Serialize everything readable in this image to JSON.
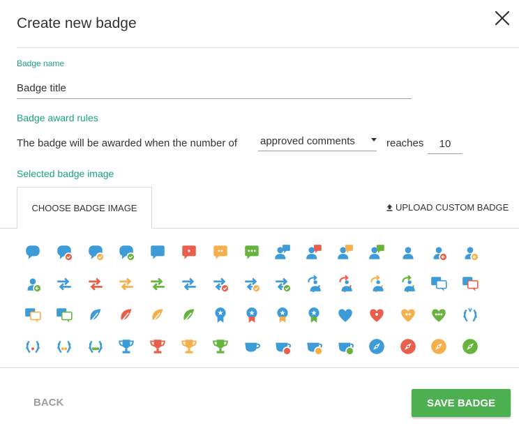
{
  "dialog": {
    "title": "Create new badge",
    "close_icon": "close-icon"
  },
  "badge_name": {
    "label": "Badge name",
    "value": "Badge title"
  },
  "award_rules": {
    "label": "Badge award rules",
    "prefix": "The badge will be awarded when the number of",
    "metric": "approved comments",
    "suffix": "reaches",
    "threshold": "10"
  },
  "image_section": {
    "label": "Selected badge image",
    "tabs": {
      "choose": "CHOOSE BADGE IMAGE",
      "upload": "UPLOAD CUSTOM BADGE",
      "upload_icon": "upload-icon"
    }
  },
  "colors": {
    "blue": "#3d9bd8",
    "red": "#e8604c",
    "yellow": "#f5b04c",
    "green": "#66b33d",
    "accent": "#1aa281",
    "save": "#4caf50"
  },
  "badge_icons": [
    [
      "chat-bubble-blue-icon",
      "chat-bubble-red-check-icon",
      "chat-bubble-yellow-check-icon",
      "chat-bubble-green-check-icon",
      "chat-square-blue-icon",
      "chat-square-red-icon",
      "chat-square-yellow-icon",
      "chat-square-green-icon",
      "user-chat-blue-icon",
      "user-chat-red-icon",
      "user-chat-yellow-icon",
      "user-chat-green-icon",
      "user-blue-icon",
      "user-red-arrow-icon",
      "user-yellow-arrow-icon"
    ],
    [
      "user-green-arrow-icon",
      "arrows-blue-icon",
      "arrows-red-icon",
      "arrows-yellow-icon",
      "arrows-green-icon",
      "arrows-blue-2-icon",
      "arrows-red-check-icon",
      "arrows-yellow-check-icon",
      "arrows-green-check-icon",
      "refresh-user-blue-icon",
      "refresh-user-red-icon",
      "refresh-user-yellow-icon",
      "refresh-user-green-icon",
      "dialog-blue-icon",
      "dialog-red-icon"
    ],
    [
      "dialog-yellow-icon",
      "dialog-green-icon",
      "leaf-blue-icon",
      "leaf-red-icon",
      "leaf-yellow-icon",
      "leaf-green-icon",
      "medal-blue-icon",
      "medal-red-icon",
      "medal-yellow-icon",
      "medal-green-icon",
      "heart-blue-icon",
      "heart-red-icon",
      "heart-yellow-icon",
      "heart-green-icon",
      "laurel-blue-icon"
    ],
    [
      "laurel-red-stars-icon",
      "laurel-yellow-stars-icon",
      "laurel-green-stars-icon",
      "trophy-blue-icon",
      "trophy-red-icon",
      "trophy-yellow-icon",
      "trophy-green-icon",
      "cup-blue-icon",
      "cup-red-icon",
      "cup-yellow-icon",
      "cup-green-icon",
      "compass-blue-icon",
      "compass-red-icon",
      "compass-yellow-icon",
      "compass-green-icon"
    ]
  ],
  "footer": {
    "back": "BACK",
    "save": "SAVE BADGE"
  }
}
